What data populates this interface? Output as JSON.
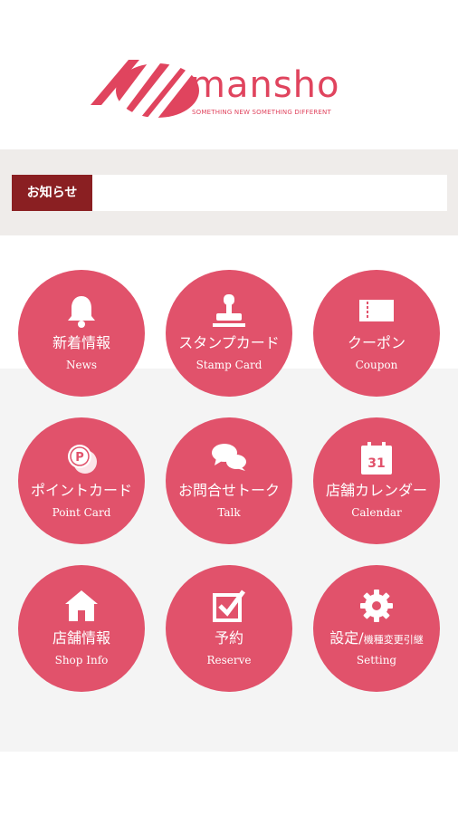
{
  "brand": {
    "name": "mansho",
    "tagline": "SOMETHING NEW SOMETHING DIFFERENT",
    "color": "#e0445e"
  },
  "news_bar": {
    "label": "お知らせ",
    "label_color": "#8a1f22"
  },
  "menu": [
    {
      "jp": "新着情報",
      "en": "News",
      "icon": "bell-icon"
    },
    {
      "jp": "スタンプカード",
      "en": "Stamp Card",
      "icon": "stamp-icon"
    },
    {
      "jp": "クーポン",
      "en": "Coupon",
      "icon": "ticket-icon"
    },
    {
      "jp": "ポイントカード",
      "en": "Point Card",
      "icon": "point-coin-icon"
    },
    {
      "jp": "お問合せトーク",
      "en": "Talk",
      "icon": "chat-bubbles-icon"
    },
    {
      "jp": "店舗カレンダー",
      "en": "Calendar",
      "icon": "calendar-icon",
      "icon_text": "31"
    },
    {
      "jp": "店舗情報",
      "en": "Shop Info",
      "icon": "house-icon"
    },
    {
      "jp": "予約",
      "en": "Reserve",
      "icon": "checkbox-icon"
    },
    {
      "jp": "設定/",
      "jp_small": "機種変更引継",
      "en": "Setting",
      "icon": "gear-icon"
    }
  ],
  "circle_color": "#e1526b"
}
